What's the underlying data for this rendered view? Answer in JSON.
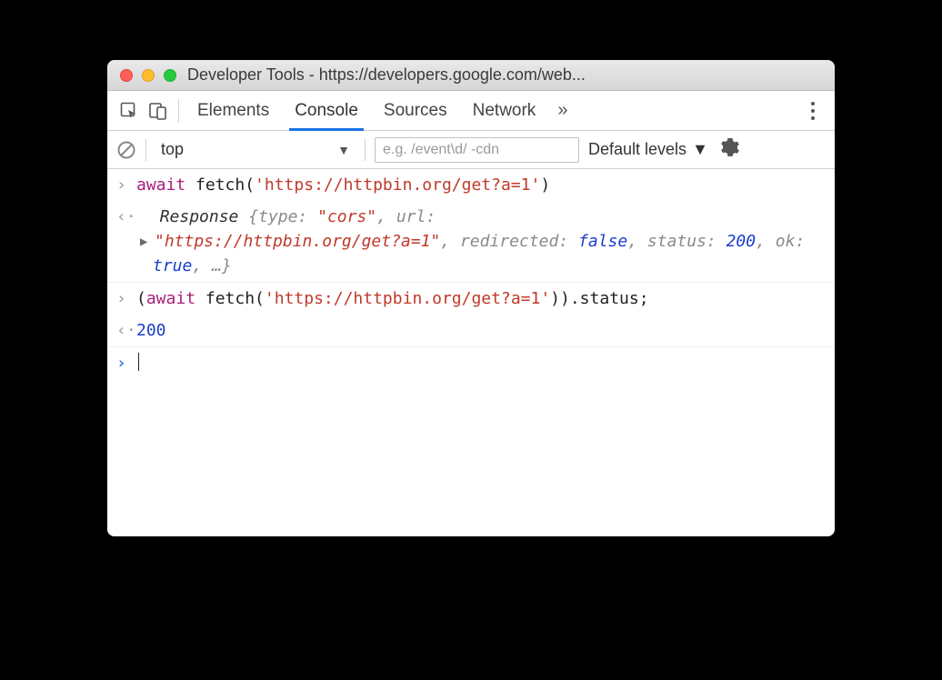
{
  "window": {
    "title": "Developer Tools - https://developers.google.com/web..."
  },
  "tabs": {
    "t0": "Elements",
    "t1": "Console",
    "t2": "Sources",
    "t3": "Network",
    "more": "»"
  },
  "toolbar": {
    "context": "top",
    "filter_placeholder": "e.g. /event\\d/ -cdn",
    "levels": "Default levels"
  },
  "console": {
    "line1": {
      "kw": "await",
      "fn": " fetch(",
      "str": "'https://httpbin.org/get?a=1'",
      "close": ")"
    },
    "line2": {
      "obj": "Response ",
      "b1": "{",
      "p_type": "type: ",
      "v_type": "\"cors\"",
      "c1": ", ",
      "p_url": "url: ",
      "v_url": "\"https://httpbin.org/get?a=1\"",
      "c2": ", ",
      "p_red": "redirected: ",
      "v_red": "false",
      "c3": ", ",
      "p_status": "status: ",
      "v_status": "200",
      "c4": ", ",
      "p_ok": "ok: ",
      "v_ok": "true",
      "c5": ", …}"
    },
    "line3": {
      "open": "(",
      "kw": "await",
      "fn": " fetch(",
      "str": "'https://httpbin.org/get?a=1'",
      "close": ")).status;"
    },
    "line4": {
      "val": "200"
    }
  }
}
